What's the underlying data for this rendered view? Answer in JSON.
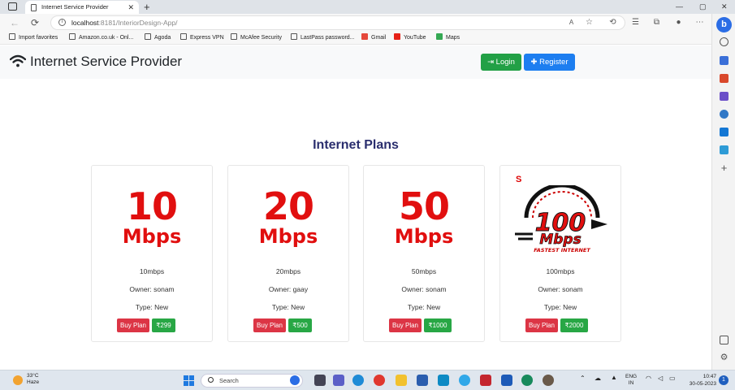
{
  "browser": {
    "tab_title": "Internet Service Provider",
    "new_tab": "+",
    "url_host": "localhost",
    "url_path": ":8181/InteriorDesign-App/",
    "window_controls": [
      "—",
      "▢",
      "✕"
    ],
    "favorites": [
      "Import favorites",
      "Amazon.co.uk - Onl...",
      "Agoda",
      "Express VPN",
      "McAfee Security",
      "LastPass password...",
      "Gmail",
      "YouTube",
      "Maps"
    ]
  },
  "site": {
    "brand": "Internet Service Provider",
    "login_label": "Login",
    "register_label": "Register",
    "heading": "Internet Plans"
  },
  "plans": [
    {
      "speed_num": "10",
      "speed_unit": "Mbps",
      "name": "10mbps",
      "owner": "Owner: sonam",
      "type": "Type: New",
      "buy": "Buy Plan",
      "price": "₹299"
    },
    {
      "speed_num": "20",
      "speed_unit": "Mbps",
      "name": "20mbps",
      "owner": "Owner: gaay",
      "type": "Type: New",
      "buy": "Buy Plan",
      "price": "₹500"
    },
    {
      "speed_num": "50",
      "speed_unit": "Mbps",
      "name": "50mbps",
      "owner": "Owner: sonam",
      "type": "Type: New",
      "buy": "Buy Plan",
      "price": "₹1000"
    },
    {
      "logo_num": "100",
      "logo_unit": "Mbps",
      "logo_tag": "FASTEST INTERNET",
      "name": "100mbps",
      "owner": "Owner: sonam",
      "type": "Type: New",
      "buy": "Buy Plan",
      "price": "₹2000"
    }
  ],
  "taskbar": {
    "temp": "33°C",
    "condition": "Haze",
    "search_placeholder": "Search",
    "lang": "ENG",
    "region": "IN",
    "time": "10:47",
    "date": "30-05-2023",
    "notifications": "1"
  },
  "colors": {
    "login": "#22a046",
    "register": "#1d7ef0",
    "buy": "#dc3545",
    "price": "#28a745",
    "heading": "#2a2e6e"
  }
}
